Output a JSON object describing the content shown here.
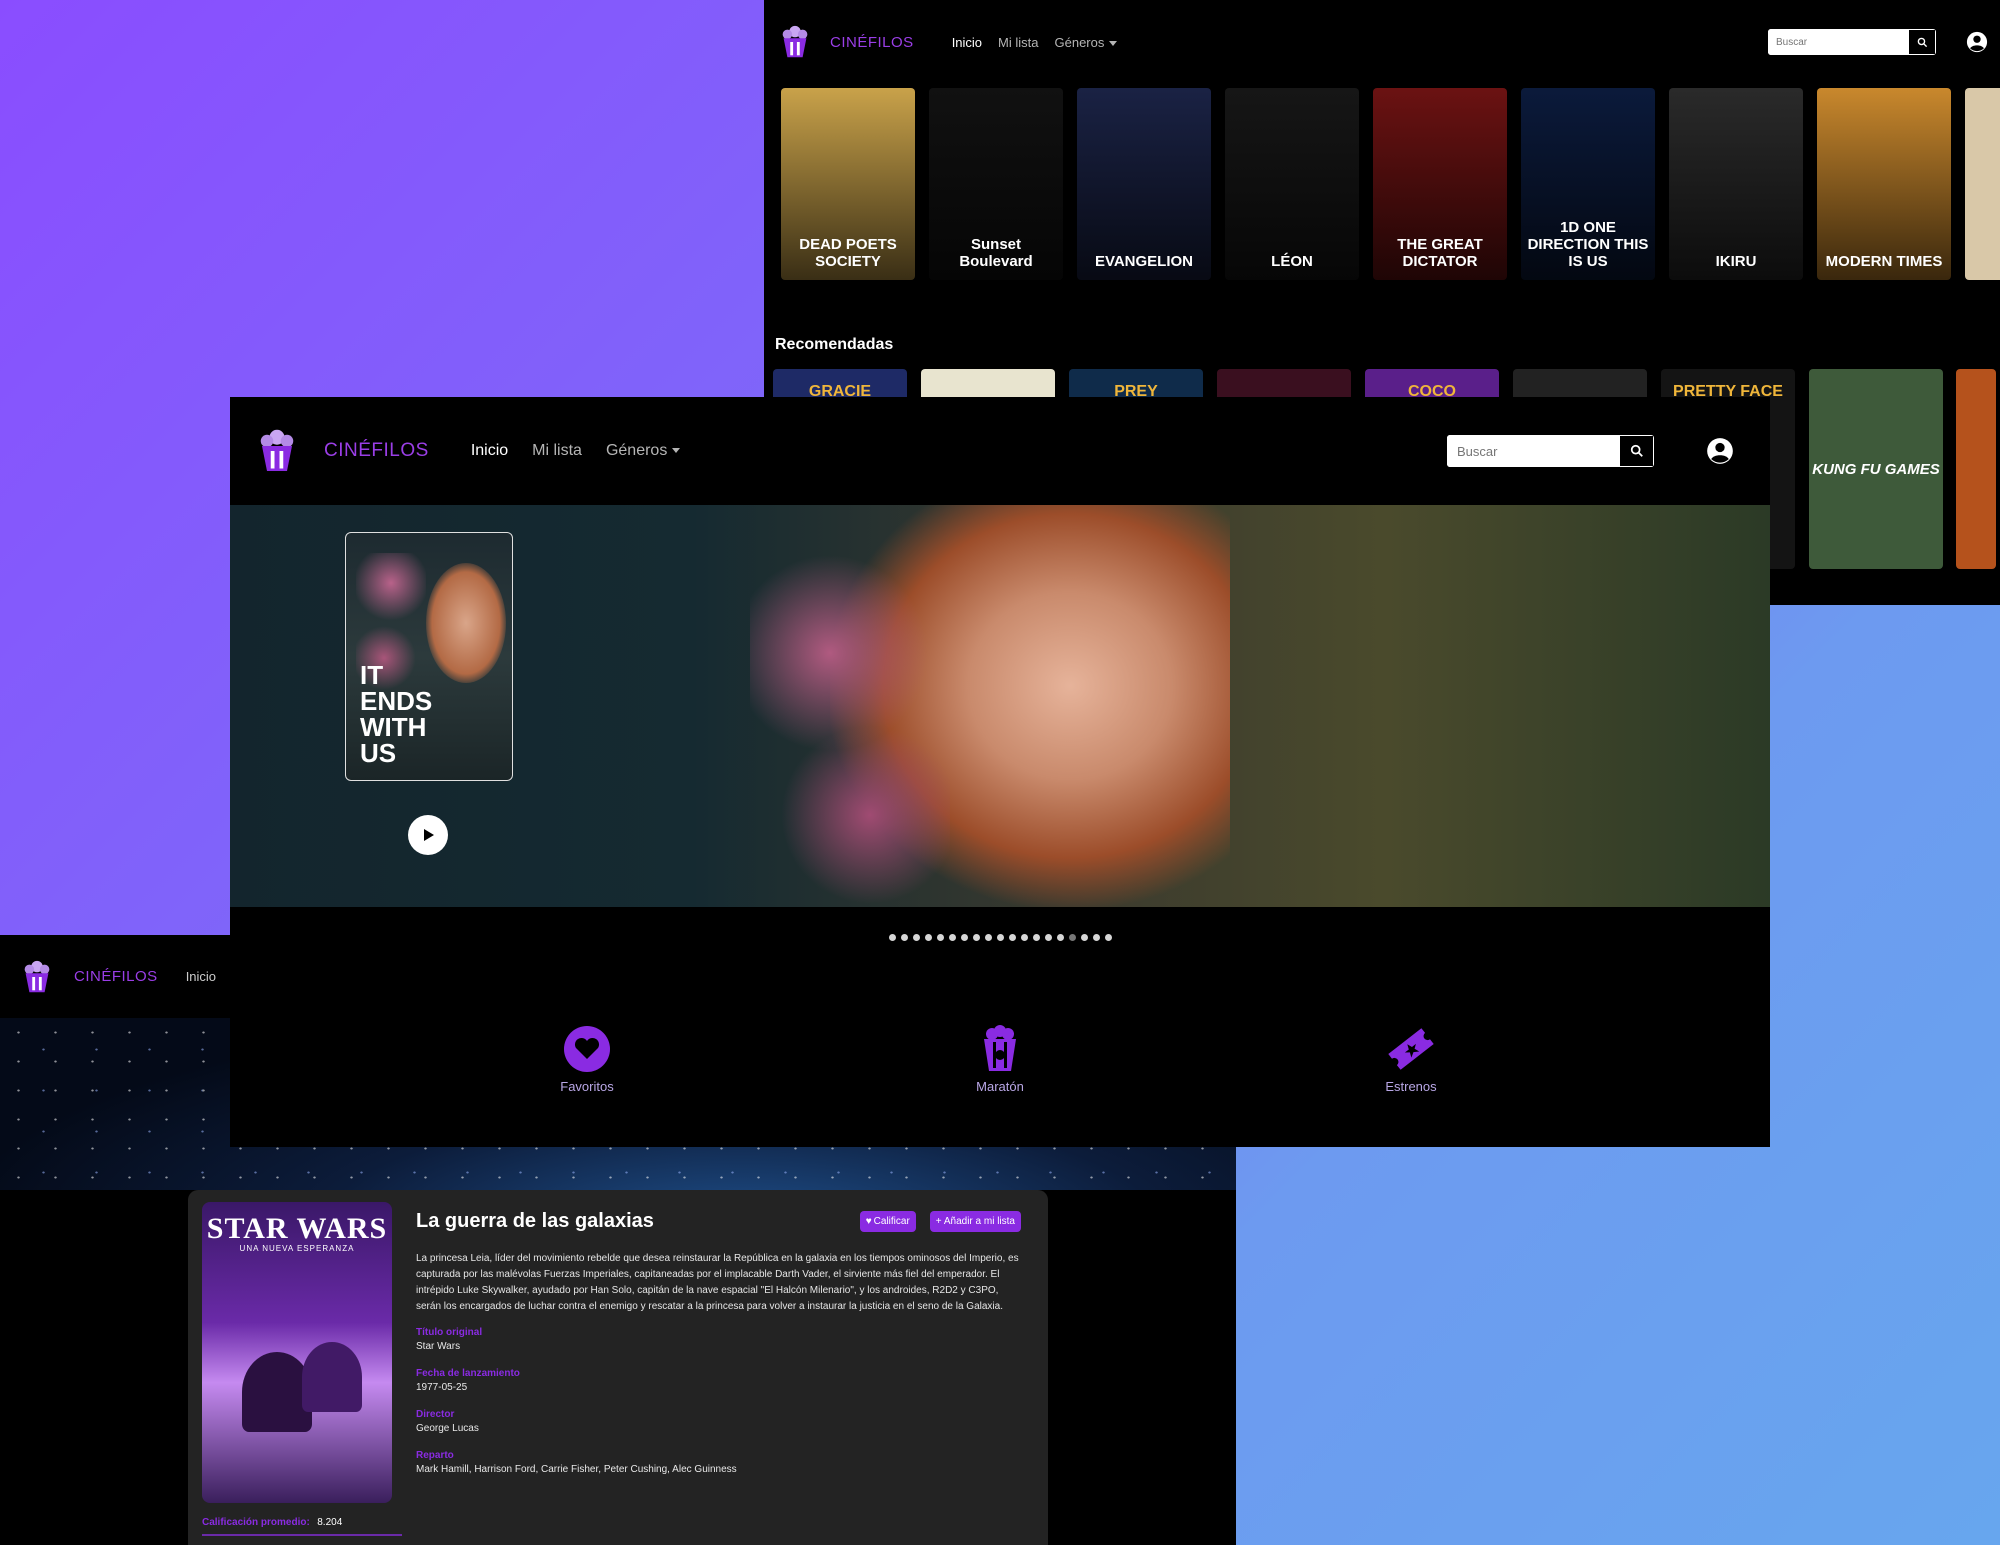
{
  "brand_name": "CINÉFILOS",
  "nav": {
    "inicio": "Inicio",
    "mi_lista": "Mi lista",
    "mi_truncated": "Mi",
    "generos": "Géneros"
  },
  "search": {
    "placeholder": "Buscar"
  },
  "shot1": {
    "posters": [
      {
        "title": "DEAD POETS SOCIETY",
        "bg": "#c9a24a"
      },
      {
        "title": "Sunset Boulevard",
        "bg": "#111111"
      },
      {
        "title": "EVANGELION",
        "bg": "#1a2244"
      },
      {
        "title": "LÉON",
        "bg": "#161616"
      },
      {
        "title": "THE GREAT DICTATOR",
        "bg": "#6b1212"
      },
      {
        "title": "1D ONE DIRECTION THIS IS US",
        "bg": "#0b1a3b"
      },
      {
        "title": "IKIRU",
        "bg": "#2a2a2a"
      },
      {
        "title": "MODERN TIMES",
        "bg": "#c9882d"
      }
    ],
    "section_title": "Recomendadas",
    "recommended": [
      {
        "title": "GRACIE",
        "bg": "#1e2a66"
      },
      {
        "title": "",
        "bg": "#e8e4cf"
      },
      {
        "title": "PREY",
        "bg": "#0f2b4a"
      },
      {
        "title": "",
        "bg": "#3a0f1f"
      },
      {
        "title": "COCO",
        "bg": "#5a1f8a"
      },
      {
        "title": "",
        "bg": "#222222"
      },
      {
        "title": "PRETTY FACE",
        "bg": "#141414"
      }
    ],
    "right_posters": [
      {
        "title": "KUNG FU GAMES",
        "bg": "#3e5a3a"
      },
      {
        "title": "",
        "bg": "#b5521c"
      }
    ]
  },
  "hero": {
    "poster_title": "IT ENDS WITH US",
    "dots_total": 19,
    "dots_active_index": 15
  },
  "categories": [
    {
      "label": "Favoritos",
      "icon": "heart-icon"
    },
    {
      "label": "Maratón",
      "icon": "popcorn-icon"
    },
    {
      "label": "Estrenos",
      "icon": "ticket-icon"
    }
  ],
  "details": {
    "poster_title": "STAR WARS",
    "poster_subtitle": "UNA NUEVA ESPERANZA",
    "title": "La guerra de las galaxias",
    "rate_button": "Calificar",
    "add_button": "+ Añadir a mi lista",
    "synopsis": "La princesa Leia, líder del movimiento rebelde que desea reinstaurar la República en la galaxia en los tiempos ominosos del Imperio, es capturada por las malévolas Fuerzas Imperiales, capitaneadas por el implacable Darth Vader, el sirviente más fiel del emperador. El intrépido Luke Skywalker, ayudado por Han Solo, capitán de la nave espacial \"El Halcón Milenario\", y los androides, R2D2 y C3PO, serán los encargados de luchar contra el enemigo y rescatar a la princesa para volver a instaurar la justicia en el seno de la Galaxia.",
    "original_title_label": "Título original",
    "original_title": "Star Wars",
    "release_label": "Fecha de lanzamiento",
    "release": "1977-05-25",
    "director_label": "Director",
    "director": "George Lucas",
    "cast_label": "Reparto",
    "cast": "Mark Hamill, Harrison Ford, Carrie Fisher, Peter Cushing, Alec Guinness",
    "rating_label": "Calificación promedio:",
    "rating_value": "8.204"
  },
  "colors": {
    "accent": "#8a2be2",
    "brand": "#9a3ee6",
    "panel": "#232323"
  }
}
